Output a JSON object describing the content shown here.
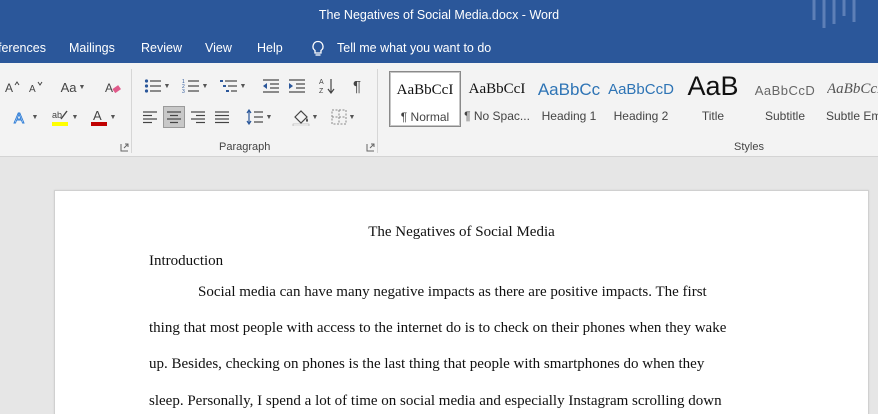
{
  "window": {
    "title": "The Negatives of Social Media.docx  -  Word"
  },
  "menu": {
    "tabs": [
      "ferences",
      "Mailings",
      "Review",
      "View",
      "Help"
    ],
    "tell_me": "Tell me what you want to do"
  },
  "ribbon": {
    "font_group": {
      "change_case_label": "Aa"
    },
    "paragraph_group": {
      "label": "Paragraph"
    },
    "styles_group": {
      "label": "Styles",
      "items": [
        {
          "sample": "AaBbCcI",
          "name": "¶ Normal",
          "selected": true
        },
        {
          "sample": "AaBbCcI",
          "name": "¶ No Spac..."
        },
        {
          "sample": "AaBbCc",
          "name": "Heading 1"
        },
        {
          "sample": "AaBbCcD",
          "name": "Heading 2"
        },
        {
          "sample": "AaB",
          "name": "Title"
        },
        {
          "sample": "AaBbCcD",
          "name": "Subtitle"
        },
        {
          "sample": "AaBbCcD",
          "name": "Subtle Em"
        }
      ]
    },
    "colors": {
      "highlight": "#ffff00",
      "font_color": "#c00000",
      "accent": "#2b579a"
    }
  },
  "document": {
    "title": "The Negatives of Social Media",
    "heading": "Introduction",
    "lines": [
      "Social media can have many negative impacts as there are positive impacts. The first",
      "thing that most people with access to the internet do is to check on their phones when they wake",
      "up. Besides, checking on phones is the last thing that people with smartphones do when they",
      "sleep. Personally, I spend a lot of time on social media and especially Instagram scrolling down"
    ]
  }
}
